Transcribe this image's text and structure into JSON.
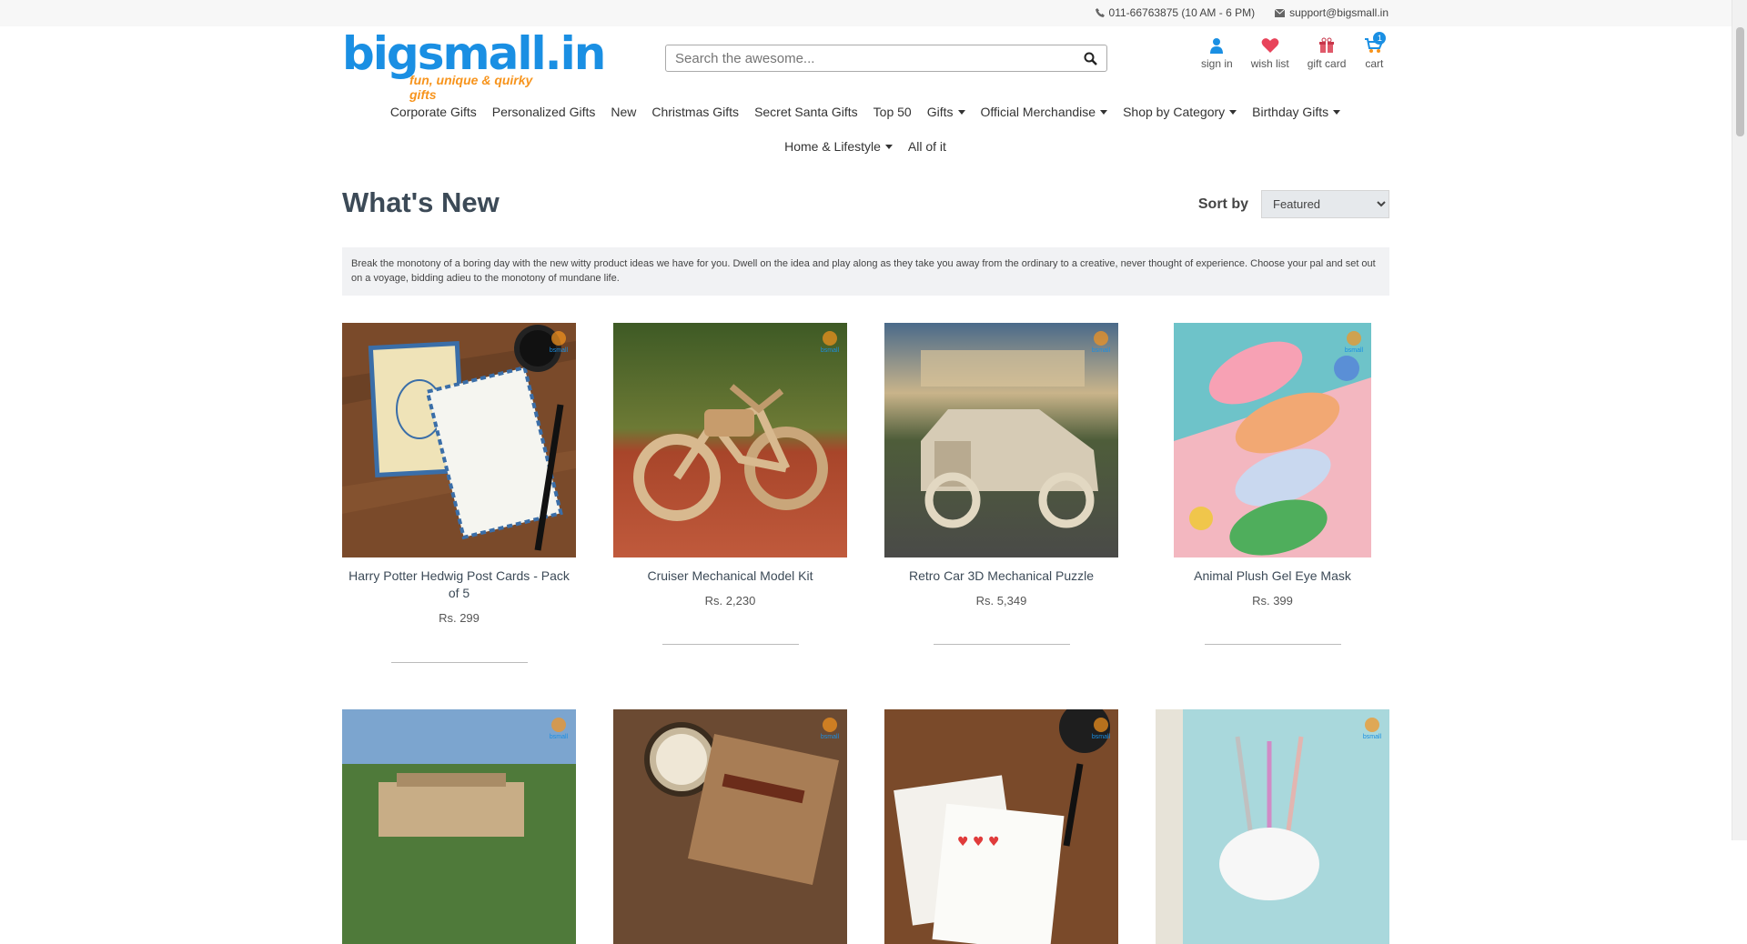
{
  "topbar": {
    "phone": "011-66763875 (10 AM - 6 PM)",
    "email": "support@bigsmall.in"
  },
  "logo": {
    "brand": "bigsmall.in",
    "tagline": "fun, unique & quirky gifts"
  },
  "search": {
    "placeholder": "Search the awesome..."
  },
  "user": {
    "signin": "sign in",
    "wishlist": "wish list",
    "giftcard": "gift card",
    "cart": "cart",
    "cart_count": "1"
  },
  "nav": {
    "row1": [
      "Corporate Gifts",
      "Personalized Gifts",
      "New",
      "Christmas Gifts",
      "Secret Santa Gifts",
      "Top 50",
      "Gifts",
      "Official Merchandise",
      "Shop by Category",
      "Birthday Gifts"
    ],
    "row2": [
      "Home & Lifestyle",
      "All of it"
    ]
  },
  "page": {
    "title": "What's New",
    "sort_label": "Sort by",
    "sort_value": "Featured",
    "description": "Break the monotony of a boring day with the new witty product ideas we have for you. Dwell on the idea and play along as they take you away from the ordinary to a creative, never thought of experience. Choose your pal and set out on a voyage, bidding adieu to the monotony of mundane life."
  },
  "products": [
    {
      "name": "Harry Potter Hedwig Post Cards - Pack of 5",
      "price": "Rs. 299"
    },
    {
      "name": "Cruiser Mechanical Model Kit",
      "price": "Rs. 2,230"
    },
    {
      "name": "Retro Car 3D Mechanical Puzzle",
      "price": "Rs. 5,349"
    },
    {
      "name": "Animal Plush Gel Eye Mask",
      "price": "Rs. 399"
    }
  ],
  "colors": {
    "brand": "#1a8fe3",
    "accent": "#f7941d",
    "title": "#3c4a57"
  }
}
